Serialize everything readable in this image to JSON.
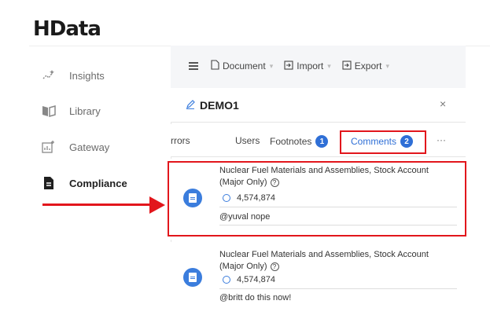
{
  "app": {
    "logo": "HData"
  },
  "sidebar": {
    "items": [
      {
        "label": "Insights",
        "icon": "sparkle-icon",
        "active": false
      },
      {
        "label": "Library",
        "icon": "book-icon",
        "active": false
      },
      {
        "label": "Gateway",
        "icon": "gateway-chart-icon",
        "active": false
      },
      {
        "label": "Compliance",
        "icon": "document-icon",
        "active": true
      }
    ]
  },
  "toolbar": {
    "document_label": "Document",
    "import_label": "Import",
    "export_label": "Export"
  },
  "panel": {
    "title": "DEMO1",
    "close_label": "×",
    "tabs": [
      {
        "label": "Errors",
        "display": "rrors"
      },
      {
        "label": "Users"
      },
      {
        "label": "Footnotes",
        "badge": "1"
      },
      {
        "label": "Comments",
        "badge": "2",
        "active": true
      }
    ],
    "more_label": "···"
  },
  "comments": [
    {
      "title": "Nuclear Fuel Materials and Assemblies, Stock Account (Major Only)",
      "value": "4,574,874",
      "body": "@yuval nope"
    },
    {
      "title": "Nuclear Fuel Materials and Assemblies, Stock Account (Major Only)",
      "value": "4,574,874",
      "body": "@britt do this now!"
    }
  ],
  "colors": {
    "accent": "#2f6fd6",
    "annotation": "#e2161c",
    "background": "#f5f6f8"
  }
}
